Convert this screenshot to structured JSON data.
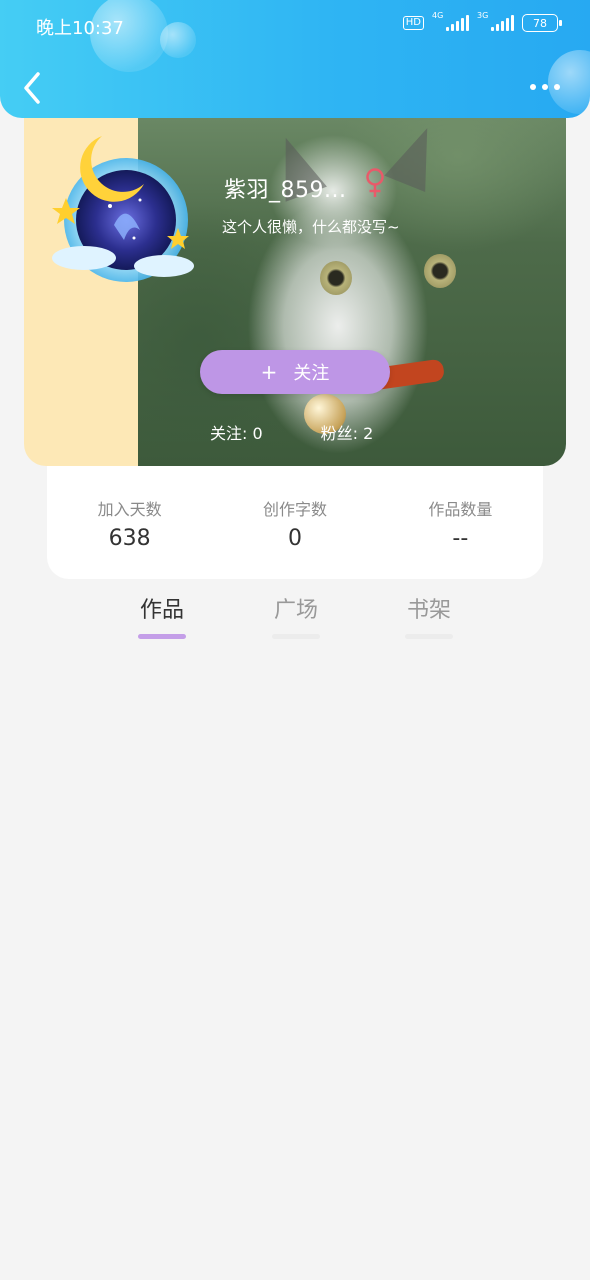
{
  "status_bar": {
    "time": "晚上10:37",
    "hd": "HD",
    "net1": "4G",
    "net2": "3G",
    "battery": "78"
  },
  "profile": {
    "username": "紫羽_859...",
    "gender": "female",
    "bio": "这个人很懒，什么都没写~",
    "follow_button": "关注",
    "follow_icon": "+",
    "following": "关注: 0",
    "fans": "粉丝: 2"
  },
  "stats": [
    {
      "label": "加入天数",
      "value": "638"
    },
    {
      "label": "创作字数",
      "value": "0"
    },
    {
      "label": "作品数量",
      "value": "--"
    }
  ],
  "tabs": [
    {
      "label": "作品",
      "active": true
    },
    {
      "label": "广场",
      "active": false
    },
    {
      "label": "书架",
      "active": false
    }
  ],
  "colors": {
    "header": "#2fb5f3",
    "follow_button": "#be96e6",
    "tab_active_underline": "#c49ee8",
    "gender_icon": "#e85a6a"
  }
}
